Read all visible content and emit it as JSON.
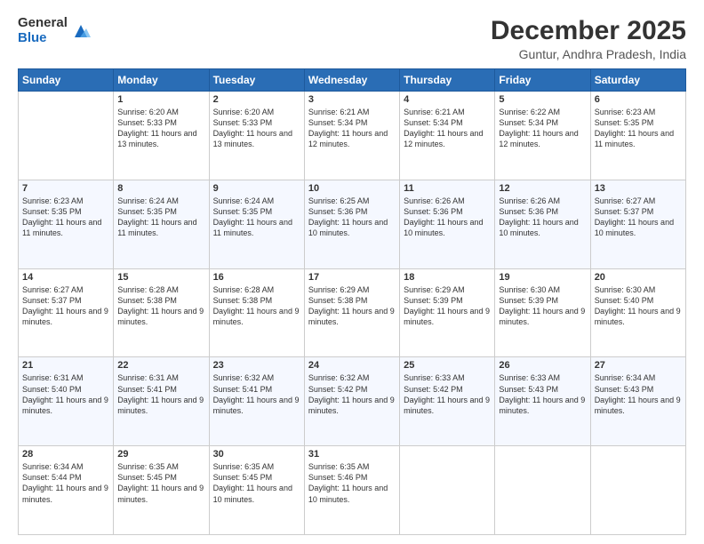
{
  "header": {
    "logo": {
      "general": "General",
      "blue": "Blue"
    },
    "title": "December 2025",
    "subtitle": "Guntur, Andhra Pradesh, India"
  },
  "calendar": {
    "days_of_week": [
      "Sunday",
      "Monday",
      "Tuesday",
      "Wednesday",
      "Thursday",
      "Friday",
      "Saturday"
    ],
    "weeks": [
      [
        {
          "day": "",
          "sunrise": "",
          "sunset": "",
          "daylight": ""
        },
        {
          "day": "1",
          "sunrise": "6:20 AM",
          "sunset": "5:33 PM",
          "daylight": "11 hours and 13 minutes."
        },
        {
          "day": "2",
          "sunrise": "6:20 AM",
          "sunset": "5:33 PM",
          "daylight": "11 hours and 13 minutes."
        },
        {
          "day": "3",
          "sunrise": "6:21 AM",
          "sunset": "5:34 PM",
          "daylight": "11 hours and 12 minutes."
        },
        {
          "day": "4",
          "sunrise": "6:21 AM",
          "sunset": "5:34 PM",
          "daylight": "11 hours and 12 minutes."
        },
        {
          "day": "5",
          "sunrise": "6:22 AM",
          "sunset": "5:34 PM",
          "daylight": "11 hours and 12 minutes."
        },
        {
          "day": "6",
          "sunrise": "6:23 AM",
          "sunset": "5:35 PM",
          "daylight": "11 hours and 11 minutes."
        }
      ],
      [
        {
          "day": "7",
          "sunrise": "6:23 AM",
          "sunset": "5:35 PM",
          "daylight": "11 hours and 11 minutes."
        },
        {
          "day": "8",
          "sunrise": "6:24 AM",
          "sunset": "5:35 PM",
          "daylight": "11 hours and 11 minutes."
        },
        {
          "day": "9",
          "sunrise": "6:24 AM",
          "sunset": "5:35 PM",
          "daylight": "11 hours and 11 minutes."
        },
        {
          "day": "10",
          "sunrise": "6:25 AM",
          "sunset": "5:36 PM",
          "daylight": "11 hours and 10 minutes."
        },
        {
          "day": "11",
          "sunrise": "6:26 AM",
          "sunset": "5:36 PM",
          "daylight": "11 hours and 10 minutes."
        },
        {
          "day": "12",
          "sunrise": "6:26 AM",
          "sunset": "5:36 PM",
          "daylight": "11 hours and 10 minutes."
        },
        {
          "day": "13",
          "sunrise": "6:27 AM",
          "sunset": "5:37 PM",
          "daylight": "11 hours and 10 minutes."
        }
      ],
      [
        {
          "day": "14",
          "sunrise": "6:27 AM",
          "sunset": "5:37 PM",
          "daylight": "11 hours and 9 minutes."
        },
        {
          "day": "15",
          "sunrise": "6:28 AM",
          "sunset": "5:38 PM",
          "daylight": "11 hours and 9 minutes."
        },
        {
          "day": "16",
          "sunrise": "6:28 AM",
          "sunset": "5:38 PM",
          "daylight": "11 hours and 9 minutes."
        },
        {
          "day": "17",
          "sunrise": "6:29 AM",
          "sunset": "5:38 PM",
          "daylight": "11 hours and 9 minutes."
        },
        {
          "day": "18",
          "sunrise": "6:29 AM",
          "sunset": "5:39 PM",
          "daylight": "11 hours and 9 minutes."
        },
        {
          "day": "19",
          "sunrise": "6:30 AM",
          "sunset": "5:39 PM",
          "daylight": "11 hours and 9 minutes."
        },
        {
          "day": "20",
          "sunrise": "6:30 AM",
          "sunset": "5:40 PM",
          "daylight": "11 hours and 9 minutes."
        }
      ],
      [
        {
          "day": "21",
          "sunrise": "6:31 AM",
          "sunset": "5:40 PM",
          "daylight": "11 hours and 9 minutes."
        },
        {
          "day": "22",
          "sunrise": "6:31 AM",
          "sunset": "5:41 PM",
          "daylight": "11 hours and 9 minutes."
        },
        {
          "day": "23",
          "sunrise": "6:32 AM",
          "sunset": "5:41 PM",
          "daylight": "11 hours and 9 minutes."
        },
        {
          "day": "24",
          "sunrise": "6:32 AM",
          "sunset": "5:42 PM",
          "daylight": "11 hours and 9 minutes."
        },
        {
          "day": "25",
          "sunrise": "6:33 AM",
          "sunset": "5:42 PM",
          "daylight": "11 hours and 9 minutes."
        },
        {
          "day": "26",
          "sunrise": "6:33 AM",
          "sunset": "5:43 PM",
          "daylight": "11 hours and 9 minutes."
        },
        {
          "day": "27",
          "sunrise": "6:34 AM",
          "sunset": "5:43 PM",
          "daylight": "11 hours and 9 minutes."
        }
      ],
      [
        {
          "day": "28",
          "sunrise": "6:34 AM",
          "sunset": "5:44 PM",
          "daylight": "11 hours and 9 minutes."
        },
        {
          "day": "29",
          "sunrise": "6:35 AM",
          "sunset": "5:45 PM",
          "daylight": "11 hours and 9 minutes."
        },
        {
          "day": "30",
          "sunrise": "6:35 AM",
          "sunset": "5:45 PM",
          "daylight": "11 hours and 10 minutes."
        },
        {
          "day": "31",
          "sunrise": "6:35 AM",
          "sunset": "5:46 PM",
          "daylight": "11 hours and 10 minutes."
        },
        {
          "day": "",
          "sunrise": "",
          "sunset": "",
          "daylight": ""
        },
        {
          "day": "",
          "sunrise": "",
          "sunset": "",
          "daylight": ""
        },
        {
          "day": "",
          "sunrise": "",
          "sunset": "",
          "daylight": ""
        }
      ]
    ]
  }
}
